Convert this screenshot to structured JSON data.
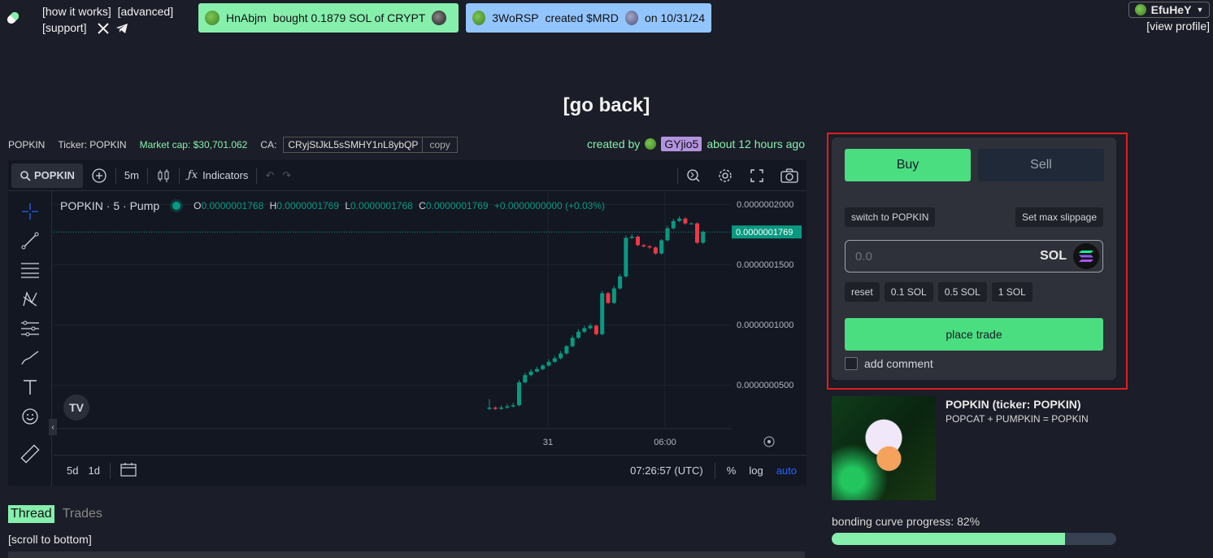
{
  "nav": {
    "how_it_works": "[how it works]",
    "advanced": "[advanced]",
    "support": "[support]"
  },
  "tickers": [
    {
      "user": "HnAbjm",
      "text": "bought 0.1879 SOL of CRYPT"
    },
    {
      "user": "3WoRSP",
      "text": "created $MRD",
      "date": "on 10/31/24"
    }
  ],
  "user": {
    "name": "EfuHeY",
    "view_profile": "[view profile]"
  },
  "go_back": "[go back]",
  "token_info": {
    "name": "POPKIN",
    "ticker": "Ticker: POPKIN",
    "market_cap": "Market cap: $30,701.062",
    "ca_label": "CA:",
    "ca": "CRyjStJkL5sSMHY1nL8ybQP",
    "copy": "copy",
    "created_by_label": "created by",
    "creator": "GYjio5",
    "created_ago": "about 12 hours ago"
  },
  "chart": {
    "symbol": "POPKIN",
    "interval": "5m",
    "indicators": "Indicators",
    "legend_title": "POPKIN · 5 · Pump",
    "ohlc": {
      "o": "0.0000001768",
      "h": "0.0000001769",
      "l": "0.0000001768",
      "c": "0.0000001769",
      "change": "+0.0000000000 (+0.03%)"
    },
    "last_price": "0.0000001769",
    "y_ticks": [
      "0.0000002000",
      "0.0000001500",
      "0.0000001000",
      "0.0000000500"
    ],
    "x_ticks": [
      "31",
      "06:00"
    ],
    "ranges": [
      "5d",
      "1d"
    ],
    "clock": "07:26:57 (UTC)",
    "scale_options": {
      "pct": "%",
      "log": "log",
      "auto": "auto"
    }
  },
  "chart_data": {
    "type": "candlestick",
    "title": "POPKIN · 5 · Pump",
    "ylim": [
      3e-08,
      2.1e-07
    ],
    "last_price": 1.769e-07,
    "candles": [
      {
        "o": 3e-08,
        "c": 3.1e-08,
        "h": 3.8e-08,
        "l": 2.9e-08
      },
      {
        "o": 3.1e-08,
        "c": 3e-08,
        "h": 3.2e-08,
        "l": 2.9e-08
      },
      {
        "o": 3e-08,
        "c": 3.1e-08,
        "h": 3.3e-08,
        "l": 2.9e-08
      },
      {
        "o": 3.1e-08,
        "c": 3.2e-08,
        "h": 3.4e-08,
        "l": 3e-08
      },
      {
        "o": 3.2e-08,
        "c": 3.3e-08,
        "h": 3.5e-08,
        "l": 3.1e-08
      },
      {
        "o": 3.3e-08,
        "c": 5.2e-08,
        "h": 5.4e-08,
        "l": 3.2e-08
      },
      {
        "o": 5.2e-08,
        "c": 5.8e-08,
        "h": 6e-08,
        "l": 5.1e-08
      },
      {
        "o": 5.8e-08,
        "c": 6.1e-08,
        "h": 6.3e-08,
        "l": 5.7e-08
      },
      {
        "o": 6.1e-08,
        "c": 6.3e-08,
        "h": 6.5e-08,
        "l": 6e-08
      },
      {
        "o": 6.3e-08,
        "c": 6.6e-08,
        "h": 6.7e-08,
        "l": 6.2e-08
      },
      {
        "o": 6.6e-08,
        "c": 6.9e-08,
        "h": 7.1e-08,
        "l": 6.5e-08
      },
      {
        "o": 6.9e-08,
        "c": 7.2e-08,
        "h": 7.4e-08,
        "l": 6.8e-08
      },
      {
        "o": 7.2e-08,
        "c": 7.6e-08,
        "h": 7.8e-08,
        "l": 7.1e-08
      },
      {
        "o": 7.6e-08,
        "c": 8.2e-08,
        "h": 8.3e-08,
        "l": 7.5e-08
      },
      {
        "o": 8.2e-08,
        "c": 8.9e-08,
        "h": 9.1e-08,
        "l": 8.1e-08
      },
      {
        "o": 8.9e-08,
        "c": 9.4e-08,
        "h": 9.6e-08,
        "l": 8.8e-08
      },
      {
        "o": 9.4e-08,
        "c": 9.7e-08,
        "h": 9.9e-08,
        "l": 9.3e-08
      },
      {
        "o": 9.7e-08,
        "c": 9.9e-08,
        "h": 1.01e-07,
        "l": 9.6e-08
      },
      {
        "o": 9.9e-08,
        "c": 9.2e-08,
        "h": 1e-07,
        "l": 9.1e-08
      },
      {
        "o": 9.2e-08,
        "c": 1.26e-07,
        "h": 1.28e-07,
        "l": 9.1e-08
      },
      {
        "o": 1.26e-07,
        "c": 1.18e-07,
        "h": 1.27e-07,
        "l": 1.17e-07
      },
      {
        "o": 1.18e-07,
        "c": 1.3e-07,
        "h": 1.32e-07,
        "l": 1.17e-07
      },
      {
        "o": 1.3e-07,
        "c": 1.4e-07,
        "h": 1.42e-07,
        "l": 1.29e-07
      },
      {
        "o": 1.4e-07,
        "c": 1.72e-07,
        "h": 1.74e-07,
        "l": 1.39e-07
      },
      {
        "o": 1.72e-07,
        "c": 1.73e-07,
        "h": 1.75e-07,
        "l": 1.71e-07
      },
      {
        "o": 1.73e-07,
        "c": 1.66e-07,
        "h": 1.74e-07,
        "l": 1.65e-07
      },
      {
        "o": 1.66e-07,
        "c": 1.65e-07,
        "h": 1.67e-07,
        "l": 1.64e-07
      },
      {
        "o": 1.65e-07,
        "c": 1.64e-07,
        "h": 1.66e-07,
        "l": 1.63e-07
      },
      {
        "o": 1.64e-07,
        "c": 1.59e-07,
        "h": 1.65e-07,
        "l": 1.58e-07
      },
      {
        "o": 1.59e-07,
        "c": 1.7e-07,
        "h": 1.71e-07,
        "l": 1.58e-07
      },
      {
        "o": 1.7e-07,
        "c": 1.8e-07,
        "h": 1.82e-07,
        "l": 1.69e-07
      },
      {
        "o": 1.8e-07,
        "c": 1.86e-07,
        "h": 1.88e-07,
        "l": 1.79e-07
      },
      {
        "o": 1.86e-07,
        "c": 1.88e-07,
        "h": 1.9e-07,
        "l": 1.85e-07
      },
      {
        "o": 1.88e-07,
        "c": 1.84e-07,
        "h": 1.89e-07,
        "l": 1.83e-07
      },
      {
        "o": 1.84e-07,
        "c": 1.84e-07,
        "h": 1.85e-07,
        "l": 1.83e-07
      },
      {
        "o": 1.84e-07,
        "c": 1.68e-07,
        "h": 1.85e-07,
        "l": 1.67e-07
      },
      {
        "o": 1.68e-07,
        "c": 1.77e-07,
        "h": 1.78e-07,
        "l": 1.67e-07
      }
    ]
  },
  "thread": {
    "tab_thread": "Thread",
    "tab_trades": "Trades",
    "scroll": "[scroll to bottom]"
  },
  "trade": {
    "buy": "Buy",
    "sell": "Sell",
    "switch": "switch to POPKIN",
    "slippage": "Set max slippage",
    "amount_placeholder": "0.0",
    "currency": "SOL",
    "quick": [
      "reset",
      "0.1 SOL",
      "0.5 SOL",
      "1 SOL"
    ],
    "place": "place trade",
    "comment": "add comment",
    "accent": "#4ade80"
  },
  "token_card": {
    "title": "POPKIN (ticker: POPKIN)",
    "description": "POPCAT + PUMPKIN = POPKIN",
    "bonding_label": "bonding curve progress: 82%",
    "bonding_progress": 82
  }
}
